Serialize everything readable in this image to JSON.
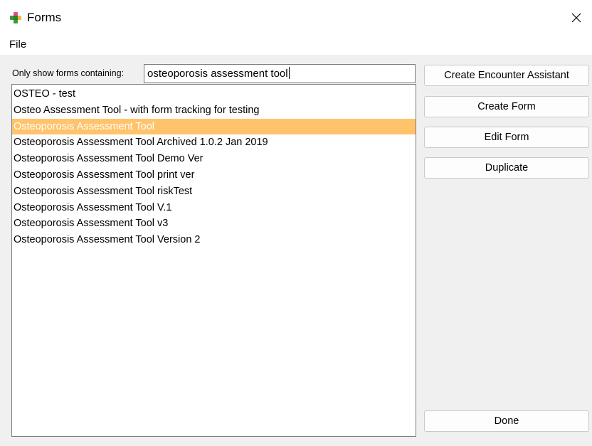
{
  "window": {
    "title": "Forms",
    "app_icon": "puzzle-piece-icon",
    "close_icon": "close-icon"
  },
  "menu": {
    "file_label": "File"
  },
  "filter": {
    "label": "Only show forms containing:",
    "value": "osteoporosis assessment tool"
  },
  "forms_list": {
    "items": [
      "OSTEO - test",
      "Osteo Assessment Tool - with form tracking for testing",
      "Osteoporosis Assessment Tool",
      "Osteoporosis Assessment Tool Archived 1.0.2 Jan 2019",
      "Osteoporosis Assessment Tool Demo Ver",
      "Osteoporosis Assessment Tool print ver",
      "Osteoporosis Assessment Tool riskTest",
      "Osteoporosis Assessment Tool V.1",
      "Osteoporosis Assessment Tool v3",
      "Osteoporosis Assessment Tool Version 2"
    ],
    "selected_index": 2,
    "selection_color": "#ffc36b"
  },
  "buttons": {
    "create_encounter_assistant": "Create Encounter Assistant",
    "create_form": "Create Form",
    "edit_form": "Edit Form",
    "duplicate": "Duplicate",
    "done": "Done"
  }
}
